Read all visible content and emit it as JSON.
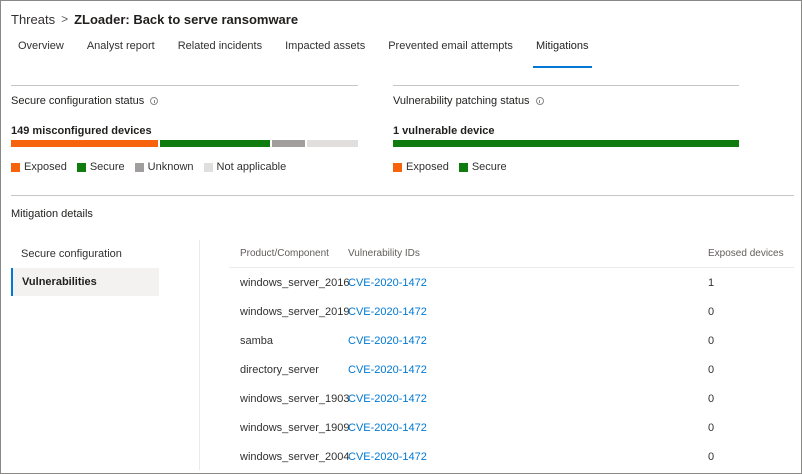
{
  "breadcrumb": {
    "parent": "Threats",
    "separator": ">",
    "current": "ZLoader: Back to serve ransomware"
  },
  "tabs": [
    {
      "label": "Overview",
      "active": false
    },
    {
      "label": "Analyst report",
      "active": false
    },
    {
      "label": "Related incidents",
      "active": false
    },
    {
      "label": "Impacted assets",
      "active": false
    },
    {
      "label": "Prevented email attempts",
      "active": false
    },
    {
      "label": "Mitigations",
      "active": true
    }
  ],
  "secure_config": {
    "title": "Secure configuration status",
    "info_icon": "info-icon",
    "count_label": "149 misconfigured devices",
    "bar_shares": {
      "exposed": 0.43,
      "secure": 0.325,
      "unknown": 0.095,
      "not_applicable": 0.15
    },
    "legend": [
      "Exposed",
      "Secure",
      "Unknown",
      "Not applicable"
    ]
  },
  "vuln_patching": {
    "title": "Vulnerability patching status",
    "info_icon": "info-icon",
    "count_label": "1 vulnerable device",
    "bar_shares": {
      "secure": 1.0
    },
    "legend": [
      "Exposed",
      "Secure"
    ]
  },
  "colors": {
    "exposed": "#f7630c",
    "secure": "#107c10",
    "unknown": "#a19f9d",
    "not_applicable": "#e1dfdd",
    "accent": "#0078d4"
  },
  "mitigation_details": {
    "title": "Mitigation details",
    "nav": [
      {
        "label": "Secure configuration",
        "active": false
      },
      {
        "label": "Vulnerabilities",
        "active": true
      }
    ],
    "table": {
      "headers": [
        "Product/Component",
        "Vulnerability IDs",
        "Exposed devices"
      ],
      "rows": [
        {
          "product": "windows_server_2016",
          "vuln_id": "CVE-2020-1472",
          "exposed": "1"
        },
        {
          "product": "windows_server_2019",
          "vuln_id": "CVE-2020-1472",
          "exposed": "0"
        },
        {
          "product": "samba",
          "vuln_id": "CVE-2020-1472",
          "exposed": "0"
        },
        {
          "product": "directory_server",
          "vuln_id": "CVE-2020-1472",
          "exposed": "0"
        },
        {
          "product": "windows_server_1903",
          "vuln_id": "CVE-2020-1472",
          "exposed": "0"
        },
        {
          "product": "windows_server_1909",
          "vuln_id": "CVE-2020-1472",
          "exposed": "0"
        },
        {
          "product": "windows_server_2004",
          "vuln_id": "CVE-2020-1472",
          "exposed": "0"
        }
      ]
    }
  }
}
